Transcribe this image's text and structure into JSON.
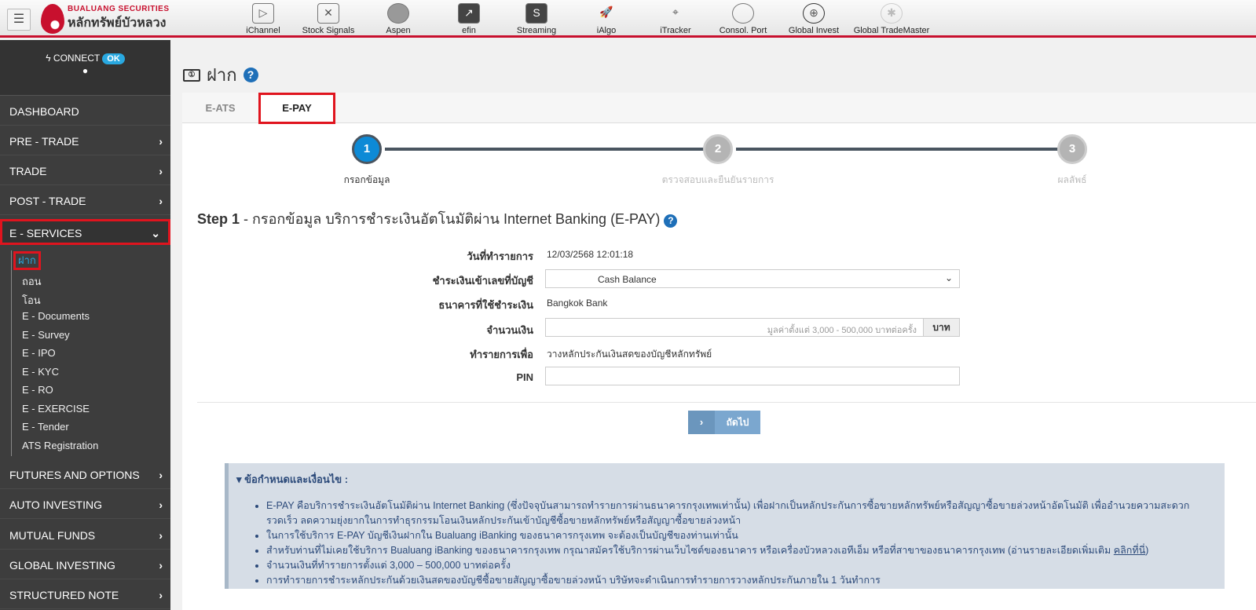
{
  "header": {
    "logo_en": "BUALUANG SECURITIES",
    "logo_th": "หลักทรัพย์บัวหลวง",
    "apps": [
      "iChannel",
      "Stock Signals",
      "Aspen",
      "efin",
      "Streaming",
      "iAlgo",
      "iTracker",
      "Consol. Port",
      "Global Invest",
      "Global TradeMaster"
    ]
  },
  "sidebar": {
    "connect": "CONNECT",
    "status": "OK",
    "items": [
      "DASHBOARD",
      "PRE - TRADE",
      "TRADE",
      "POST - TRADE",
      "E - SERVICES",
      "FUTURES AND OPTIONS",
      "AUTO INVESTING",
      "MUTUAL FUNDS",
      "GLOBAL INVESTING",
      "STRUCTURED NOTE"
    ],
    "sub_items": [
      "ฝาก",
      "ถอน",
      "โอน",
      "E - Documents",
      "E - Survey",
      "E - IPO",
      "E - KYC",
      "E - RO",
      "E - EXERCISE",
      "E - Tender",
      "ATS Registration"
    ]
  },
  "page": {
    "title": "ฝาก",
    "tabs": [
      "E-ATS",
      "E-PAY"
    ],
    "steps": [
      {
        "num": "1",
        "label": "กรอกข้อมูล"
      },
      {
        "num": "2",
        "label": "ตรวจสอบและยืนยันรายการ"
      },
      {
        "num": "3",
        "label": "ผลลัพธ์"
      }
    ],
    "heading_bold": "Step 1",
    "heading_rest": " - กรอกข้อมูล บริการชำระเงินอัตโนมัติผ่าน Internet Banking (E-PAY)",
    "form": {
      "date_label": "วันที่ทำรายการ",
      "date_value": "12/03/2568 12:01:18",
      "account_label": "ชำระเงินเข้าเลขที่บัญชี",
      "account_value": "Cash Balance",
      "bank_label": "ธนาคารที่ใช้ชำระเงิน",
      "bank_value": "Bangkok Bank",
      "amount_label": "จำนวนเงิน",
      "amount_placeholder": "มูลค่าตั้งแต่ 3,000 - 500,000 บาทต่อครั้ง",
      "amount_unit": "บาท",
      "purpose_label": "ทำรายการเพื่อ",
      "purpose_value": "วางหลักประกันเงินสดของบัญชีหลักทรัพย์",
      "pin_label": "PIN",
      "pin_value": ""
    },
    "next_label": "ถัดไป",
    "terms": {
      "title": "ข้อกำหนดและเงื่อนไข :",
      "items": [
        "E-PAY คือบริการชำระเงินอัตโนมัติผ่าน Internet Banking (ซึ่งปัจจุบันสามารถทำรายการผ่านธนาคารกรุงเทพเท่านั้น) เพื่อฝากเป็นหลักประกันการซื้อขายหลักทรัพย์หรือสัญญาซื้อขายล่วงหน้าอัตโนมัติ เพื่ออำนวยความสะดวก รวดเร็ว ลดความยุ่งยากในการทำธุรกรรมโอนเงินหลักประกันเข้าบัญชีซื้อขายหลักทรัพย์หรือสัญญาซื้อขายล่วงหน้า",
        "ในการใช้บริการ E-PAY บัญชีเงินฝากใน Bualuang iBanking ของธนาคารกรุงเทพ จะต้องเป็นบัญชีของท่านเท่านั้น",
        "สำหรับท่านที่ไม่เคยใช้บริการ Bualuang iBanking ของธนาคารกรุงเทพ กรุณาสมัครใช้บริการผ่านเว็บไซต์ของธนาคาร หรือเครื่องบัวหลวงเอทีเอ็ม หรือที่สาขาของธนาคารกรุงเทพ (อ่านรายละเอียดเพิ่มเติม ",
        "จำนวนเงินที่ทำรายการตั้งแต่ 3,000 – 500,000 บาทต่อครั้ง",
        "การทำรายการชำระหลักประกันด้วยเงินสดของบัญชีซื้อขายสัญญาซื้อขายล่วงหน้า บริษัทจะดำเนินการทำรายการวางหลักประกันภายใน 1 วันทำการ"
      ],
      "link": "คลิกที่นี่",
      "link_suffix": ")"
    }
  },
  "colors": {
    "brand": "#c8102e",
    "accent": "#0d8ad6",
    "highlight": "#e0141e"
  }
}
